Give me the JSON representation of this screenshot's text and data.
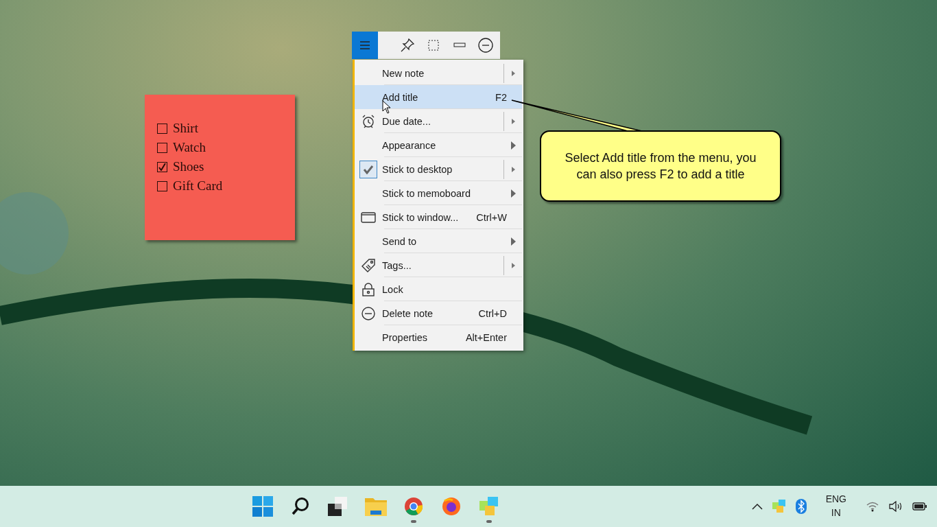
{
  "note": {
    "items": [
      {
        "label": "Shirt",
        "checked": false
      },
      {
        "label": "Watch",
        "checked": false
      },
      {
        "label": "Shoes",
        "checked": true
      },
      {
        "label": "Gift Card",
        "checked": false
      }
    ]
  },
  "toolbar": {
    "menu_open": true
  },
  "menu": {
    "items": [
      {
        "label": "New note",
        "kind": "split",
        "selected": false
      },
      {
        "label": "Add title",
        "kind": "shortcut",
        "shortcut": "F2",
        "selected": true
      },
      {
        "label": "Due date...",
        "kind": "split",
        "selected": false
      },
      {
        "label": "Appearance",
        "kind": "submenu",
        "selected": false
      },
      {
        "label": "Stick to desktop",
        "kind": "split",
        "selected": false,
        "checked": true
      },
      {
        "label": "Stick to memoboard",
        "kind": "submenu",
        "selected": false
      },
      {
        "label": "Stick to window...",
        "kind": "shortcut",
        "shortcut": "Ctrl+W",
        "selected": false
      },
      {
        "label": "Send to",
        "kind": "submenu",
        "selected": false
      },
      {
        "label": "Tags...",
        "kind": "split",
        "selected": false
      },
      {
        "label": "Lock",
        "kind": "plain",
        "selected": false
      },
      {
        "label": "Delete note",
        "kind": "shortcut",
        "shortcut": "Ctrl+D",
        "selected": false
      },
      {
        "label": "Properties",
        "kind": "shortcut",
        "shortcut": "Alt+Enter",
        "selected": false
      }
    ]
  },
  "callout": {
    "text": "Select Add title from the menu, you can also press F2 to add a title"
  },
  "taskbar": {
    "apps": [
      {
        "kind": "start",
        "running": false
      },
      {
        "kind": "search",
        "running": false
      },
      {
        "kind": "taskview",
        "running": false
      },
      {
        "kind": "folder",
        "running": false
      },
      {
        "kind": "chrome",
        "running": true
      },
      {
        "kind": "firefox",
        "running": false
      },
      {
        "kind": "notes",
        "running": true
      }
    ],
    "language": "ENG",
    "region": "IN"
  }
}
